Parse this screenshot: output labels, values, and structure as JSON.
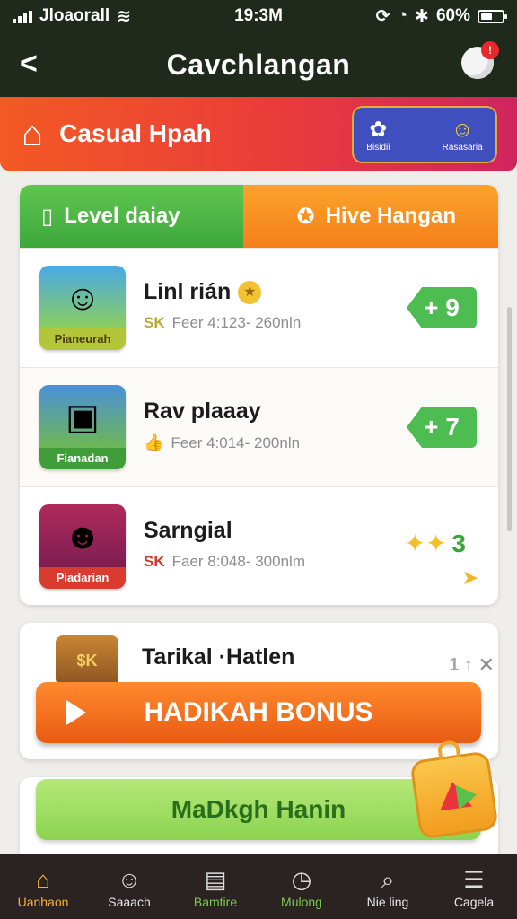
{
  "status_bar": {
    "carrier": "Jloaorall",
    "time": "1⁠9:3M",
    "battery": "60%"
  },
  "header": {
    "title": "Cavchlangan",
    "notification_count": "!"
  },
  "banner": {
    "title": "Casual Hpah",
    "chip_left_label": "Bisidii",
    "chip_right_label": "Rasasaria"
  },
  "tabs": [
    {
      "label": "Level daiay"
    },
    {
      "label": "Hive Hangan"
    }
  ],
  "games": [
    {
      "thumb_caption": "Pianeurah",
      "title": "Linl rián",
      "prefix": "SK",
      "meta": "Feer 4:123- 260nln",
      "reward": "+ 9"
    },
    {
      "thumb_caption": "Fianadan",
      "title": "Rav plaaay",
      "prefix": "",
      "meta": "Feer 4:014- 200nln",
      "reward": "+ 7"
    },
    {
      "thumb_caption": "Piadarian",
      "title": "Sarngial",
      "prefix": "SK",
      "meta": "Faer 8:048- 300nlm",
      "reward": "3"
    }
  ],
  "partial_row": {
    "title": "Tarikal ·Hatlen",
    "right": "1 ↑",
    "chest_label": "$K"
  },
  "buttons": {
    "bonus": "HADIKAH BONUS",
    "green": "MaDkgh Hanin"
  },
  "bottom_nav": [
    {
      "label": "Uanhaon",
      "icon": "home-icon"
    },
    {
      "label": "Saaach",
      "icon": "person-icon"
    },
    {
      "label": "Bamtire",
      "icon": "clipboard-icon"
    },
    {
      "label": "Mulong",
      "icon": "timer-icon"
    },
    {
      "label": "Nie ling",
      "icon": "search-icon"
    },
    {
      "label": "Cagela",
      "icon": "menu-icon"
    }
  ],
  "colors": {
    "header_bg": "#1f2a1d",
    "banner_start": "#f25a24",
    "banner_end": "#d0245f",
    "tab_green": "#4cb545",
    "tab_orange": "#f7921f",
    "reward_green": "#4dbd52",
    "bonus_orange": "#f0701c",
    "nav_bg": "#2b2222",
    "nav_active": "#f5b32a"
  }
}
